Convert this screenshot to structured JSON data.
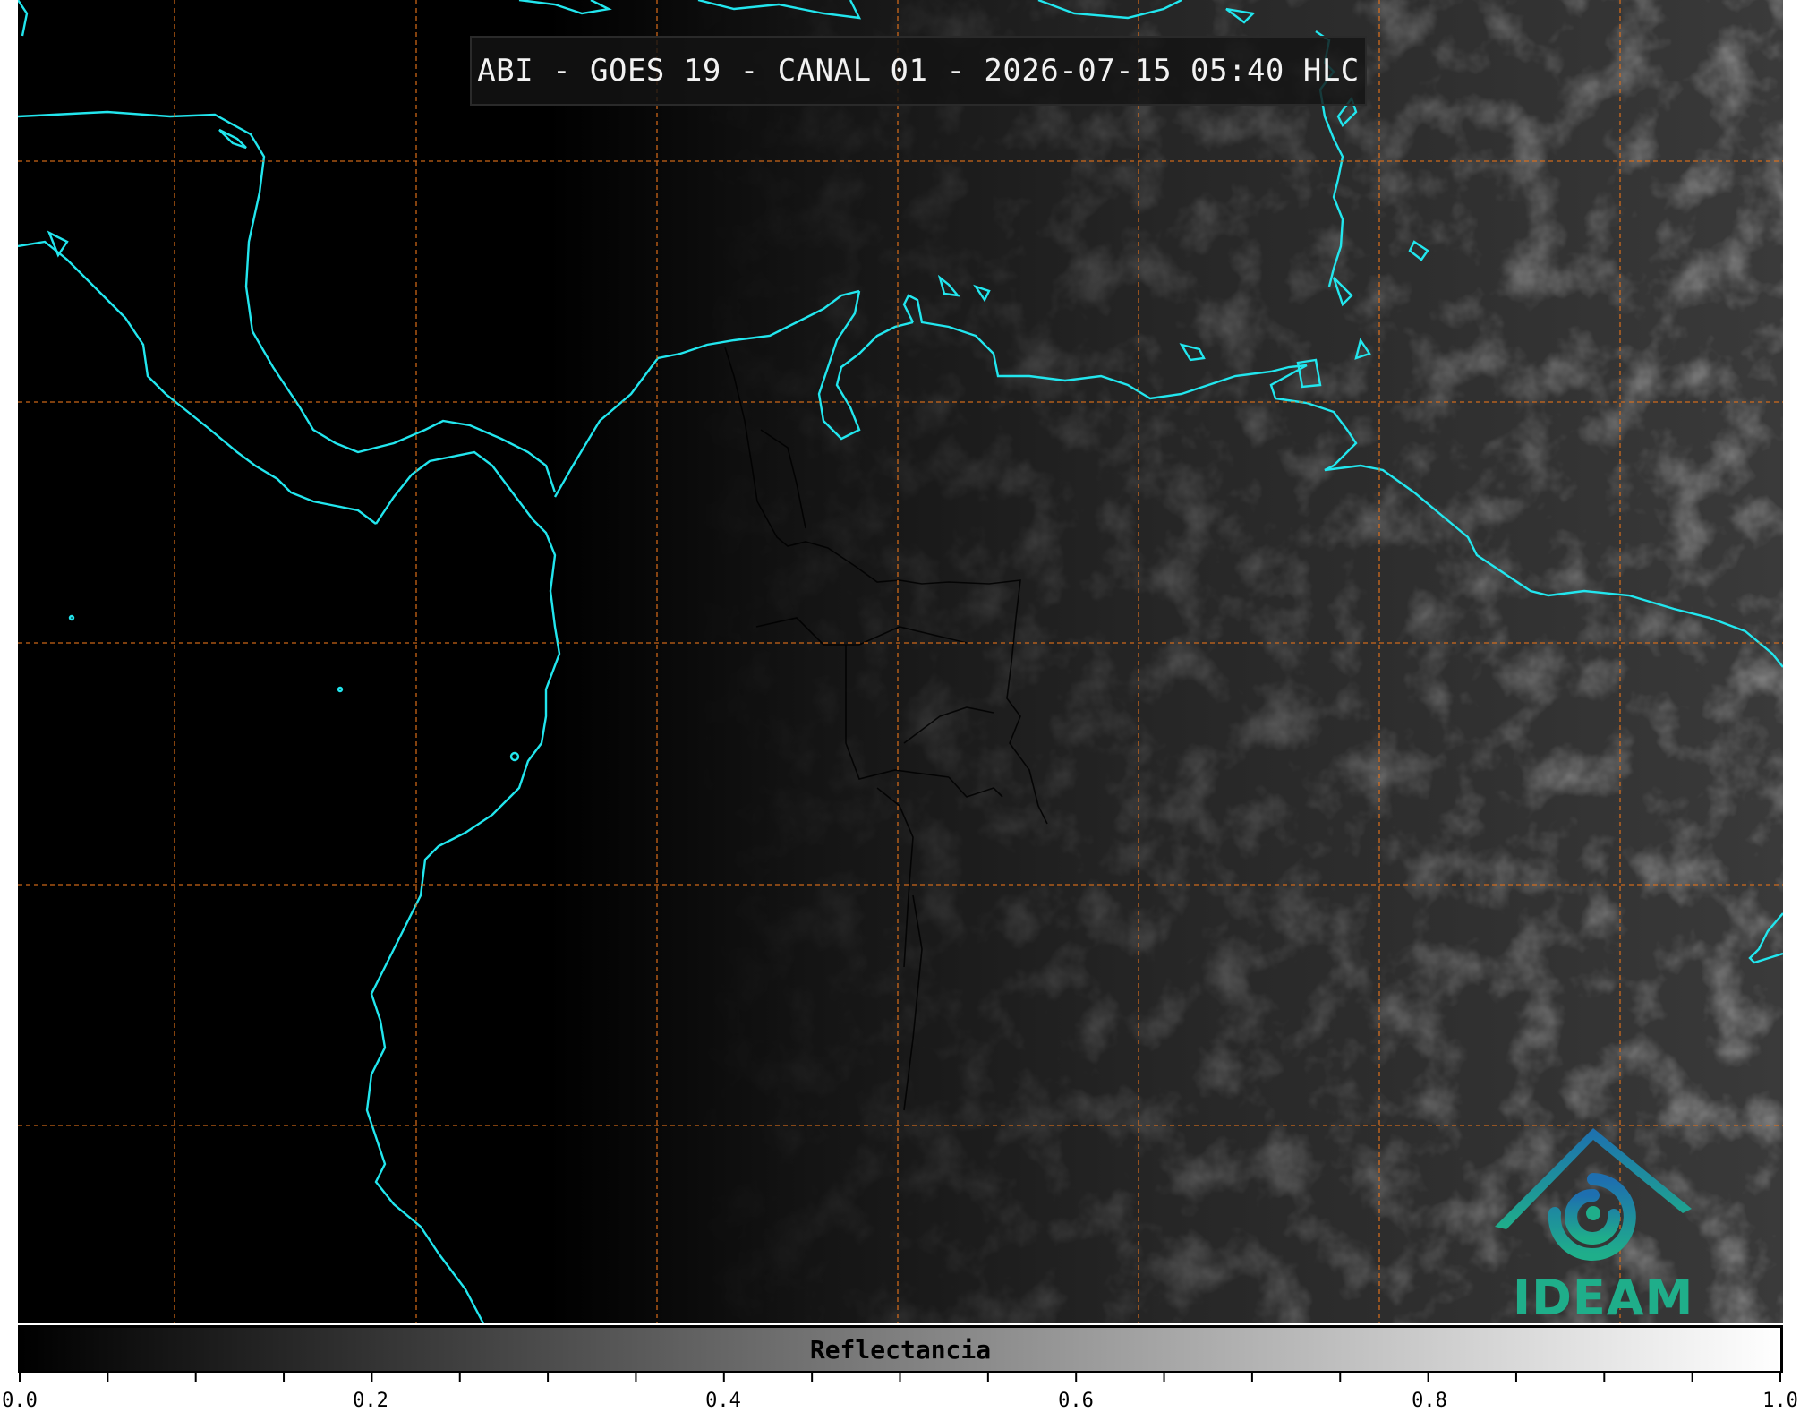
{
  "title": "ABI - GOES 19 - CANAL 01 - 2026-07-15 05:40 HLC",
  "colorbar": {
    "label": "Reflectancia",
    "range": [
      0.0,
      1.0
    ],
    "major_ticks": [
      "0.0",
      "0.2",
      "0.4",
      "0.6",
      "0.8",
      "1.0"
    ],
    "minor_tick_step": 0.05,
    "colormap": "grayscale (black to white)"
  },
  "logo": {
    "text": "IDEAM",
    "colors": {
      "primary": "#1fae8a",
      "secondary": "#1e6fb0"
    }
  },
  "map": {
    "coastline_color": "#22e6ee",
    "gridline_color": "#e0701a",
    "gridline_style": "dashed",
    "border_color": "#000000",
    "background": "satellite visible imagery, night side dark on left"
  }
}
